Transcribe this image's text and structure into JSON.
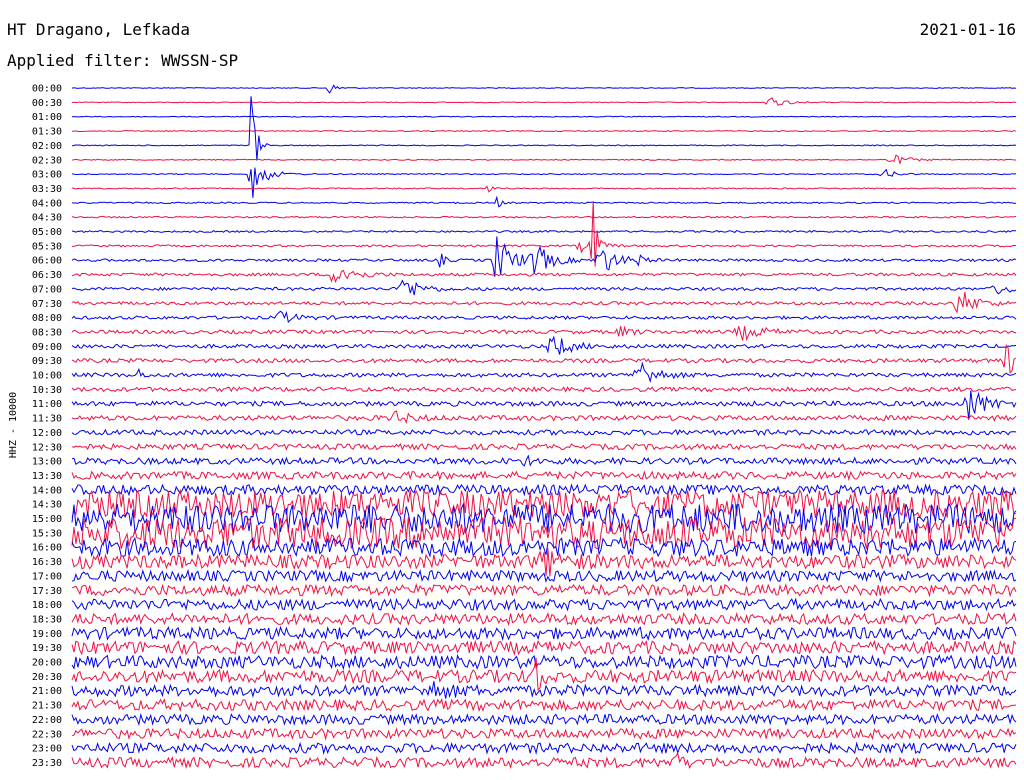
{
  "header": {
    "station": "HT Dragano, Lefkada",
    "filter": "Applied filter: WWSSN-SP",
    "date": "2021-01-16"
  },
  "colors": {
    "trace_a": "#0000ee",
    "trace_b": "#ee1144"
  },
  "chart_data": {
    "type": "line",
    "title": "HT Dragano, Lefkada",
    "subtitle": "Applied filter: WWSSN-SP",
    "date": "2021-01-16",
    "ylabel": "HHZ - 10000",
    "row_labels": [
      "00:00",
      "00:30",
      "01:00",
      "01:30",
      "02:00",
      "02:30",
      "03:00",
      "03:30",
      "04:00",
      "04:30",
      "05:00",
      "05:30",
      "06:00",
      "06:30",
      "07:00",
      "07:30",
      "08:00",
      "08:30",
      "09:00",
      "09:30",
      "10:00",
      "10:30",
      "11:00",
      "11:30",
      "12:00",
      "12:30",
      "13:00",
      "13:30",
      "14:00",
      "14:30",
      "15:00",
      "15:30",
      "16:00",
      "16:30",
      "17:00",
      "17:30",
      "18:00",
      "18:30",
      "19:00",
      "19:30",
      "20:00",
      "20:30",
      "21:00",
      "21:30",
      "22:00",
      "22:30",
      "23:00",
      "23:30"
    ],
    "row_noise": [
      0.4,
      0.4,
      0.4,
      0.5,
      0.5,
      0.5,
      0.5,
      0.6,
      0.7,
      0.8,
      0.9,
      1.0,
      1.3,
      1.5,
      1.5,
      1.6,
      1.6,
      1.8,
      1.9,
      2.0,
      2.0,
      2.2,
      2.4,
      2.5,
      2.6,
      2.8,
      3.2,
      3.8,
      5.0,
      14.0,
      15.0,
      16.0,
      9.0,
      7.0,
      5.5,
      5.5,
      5.5,
      5.5,
      6.0,
      6.5,
      6.5,
      6.5,
      5.5,
      5.5,
      5.0,
      5.0,
      5.0,
      5.0
    ],
    "events": [
      {
        "row": 0,
        "pos": 0.27,
        "amp": 8,
        "dur": 0.01
      },
      {
        "row": 1,
        "pos": 0.74,
        "amp": 5,
        "dur": 0.02
      },
      {
        "row": 4,
        "pos": 0.19,
        "amp": 90,
        "dur": 0.005
      },
      {
        "row": 5,
        "pos": 0.87,
        "amp": 5,
        "dur": 0.02
      },
      {
        "row": 6,
        "pos": 0.19,
        "amp": 28,
        "dur": 0.015
      },
      {
        "row": 6,
        "pos": 0.86,
        "amp": 5,
        "dur": 0.015
      },
      {
        "row": 7,
        "pos": 0.44,
        "amp": 5,
        "dur": 0.005
      },
      {
        "row": 8,
        "pos": 0.45,
        "amp": 7,
        "dur": 0.005
      },
      {
        "row": 11,
        "pos": 0.54,
        "amp": 6,
        "dur": 0.02
      },
      {
        "row": 11,
        "pos": 0.55,
        "amp": 130,
        "dur": 0.004
      },
      {
        "row": 12,
        "pos": 0.39,
        "amp": 10,
        "dur": 0.005
      },
      {
        "row": 12,
        "pos": 0.45,
        "amp": 26,
        "dur": 0.02
      },
      {
        "row": 12,
        "pos": 0.49,
        "amp": 16,
        "dur": 0.02
      },
      {
        "row": 12,
        "pos": 0.56,
        "amp": 16,
        "dur": 0.02
      },
      {
        "row": 12,
        "pos": 0.6,
        "amp": 8,
        "dur": 0.005
      },
      {
        "row": 13,
        "pos": 0.28,
        "amp": 15,
        "dur": 0.02
      },
      {
        "row": 14,
        "pos": 0.35,
        "amp": 14,
        "dur": 0.02
      },
      {
        "row": 14,
        "pos": 0.98,
        "amp": 5,
        "dur": 0.02
      },
      {
        "row": 15,
        "pos": 0.94,
        "amp": 15,
        "dur": 0.02
      },
      {
        "row": 16,
        "pos": 0.22,
        "amp": 6,
        "dur": 0.02
      },
      {
        "row": 17,
        "pos": 0.58,
        "amp": 5,
        "dur": 0.015
      },
      {
        "row": 17,
        "pos": 0.71,
        "amp": 7,
        "dur": 0.03
      },
      {
        "row": 18,
        "pos": 0.51,
        "amp": 12,
        "dur": 0.02
      },
      {
        "row": 19,
        "pos": 0.99,
        "amp": 16,
        "dur": 0.02
      },
      {
        "row": 20,
        "pos": 0.07,
        "amp": 6,
        "dur": 0.005
      },
      {
        "row": 20,
        "pos": 0.6,
        "amp": 16,
        "dur": 0.02
      },
      {
        "row": 22,
        "pos": 0.95,
        "amp": 18,
        "dur": 0.02
      },
      {
        "row": 23,
        "pos": 0.34,
        "amp": 6,
        "dur": 0.02
      },
      {
        "row": 26,
        "pos": 0.48,
        "amp": 10,
        "dur": 0.005
      },
      {
        "row": 33,
        "pos": 0.5,
        "amp": 12,
        "dur": 0.02
      },
      {
        "row": 41,
        "pos": 0.49,
        "amp": 40,
        "dur": 0.005
      },
      {
        "row": 42,
        "pos": 0.38,
        "amp": 8,
        "dur": 0.02
      },
      {
        "row": 47,
        "pos": 0.64,
        "amp": 14,
        "dur": 0.005
      }
    ]
  }
}
